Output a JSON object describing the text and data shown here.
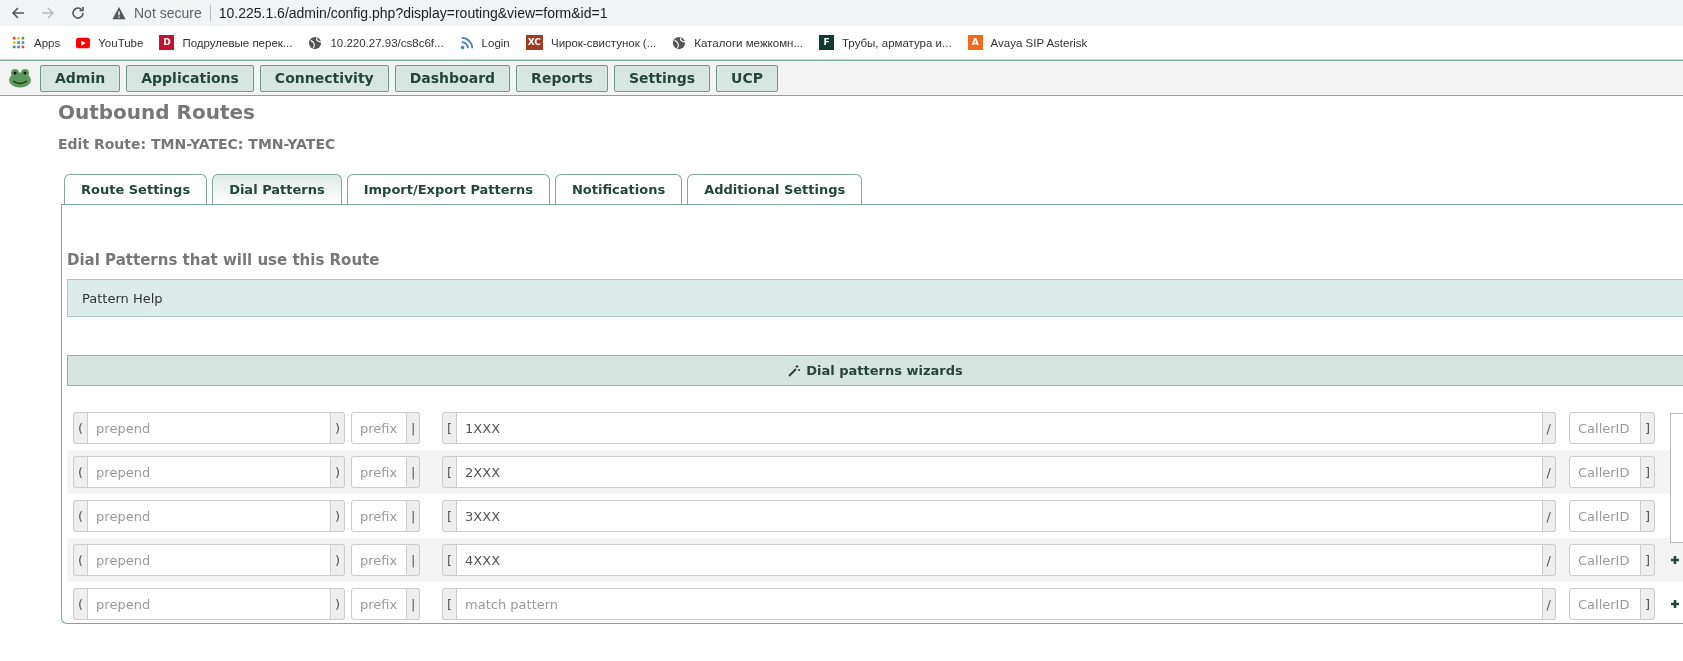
{
  "browser": {
    "security": "Not secure",
    "url": "10.225.1.6/admin/config.php?display=routing&view=form&id=1",
    "bookmarks": [
      {
        "kind": "apps",
        "label": "Apps"
      },
      {
        "kind": "youtube",
        "label": "YouTube"
      },
      {
        "kind": "badge",
        "badge": "D",
        "color": "#c8102e",
        "label": "Подрулевые перек..."
      },
      {
        "kind": "globe",
        "label": "10.220.27.93/cs8c6f..."
      },
      {
        "kind": "rss",
        "label": "Login"
      },
      {
        "kind": "badge",
        "badge": "XC",
        "color": "#a33a22",
        "label": "Чирок-свистунок (..."
      },
      {
        "kind": "globe",
        "label": "Каталоги межкомн..."
      },
      {
        "kind": "badge",
        "badge": "F",
        "color": "#0e3b2e",
        "label": "Трубы, арматура и..."
      },
      {
        "kind": "badge",
        "badge": "A",
        "color": "#f26b1d",
        "label": "Avaya SIP Asterisk"
      }
    ]
  },
  "menu": [
    "Admin",
    "Applications",
    "Connectivity",
    "Dashboard",
    "Reports",
    "Settings",
    "UCP"
  ],
  "page_title": "Outbound Routes",
  "subtitle": "Edit Route: TMN-YATEC: TMN-YATEC",
  "tabs": [
    {
      "label": "Route Settings",
      "selected": false
    },
    {
      "label": "Dial Patterns",
      "selected": true
    },
    {
      "label": "Import/Export Patterns",
      "selected": false
    },
    {
      "label": "Notifications",
      "selected": false
    },
    {
      "label": "Additional Settings",
      "selected": false
    }
  ],
  "section_title": "Dial Patterns that will use this Route",
  "pattern_help": "Pattern Help",
  "wizard_button": "Dial patterns wizards",
  "patterns": [
    {
      "addons": [
        "(",
        ")",
        "|",
        "[",
        "/",
        "]"
      ],
      "prepend_placeholder": "prepend",
      "prefix_placeholder": "prefix",
      "match": "1XXX",
      "callerid_placeholder": "CallerID",
      "add": false
    },
    {
      "addons": [
        "(",
        ")",
        "|",
        "[",
        "/",
        "]"
      ],
      "prepend_placeholder": "prepend",
      "prefix_placeholder": "prefix",
      "match": "2XXX",
      "callerid_placeholder": "CallerID",
      "add": false
    },
    {
      "addons": [
        "(",
        ")",
        "|",
        "[",
        "/",
        "]"
      ],
      "prepend_placeholder": "prepend",
      "prefix_placeholder": "prefix",
      "match": "3XXX",
      "callerid_placeholder": "CallerID",
      "add": false
    },
    {
      "addons": [
        "(",
        ")",
        "|",
        "[",
        "/",
        "]"
      ],
      "prepend_placeholder": "prepend",
      "prefix_placeholder": "prefix",
      "match": "4XXX",
      "callerid_placeholder": "CallerID",
      "add": true
    },
    {
      "addons": [
        "(",
        ")",
        "|",
        "[",
        "/",
        "]"
      ],
      "prepend_placeholder": "prepend",
      "prefix_placeholder": "prefix",
      "match_placeholder": "match pattern",
      "callerid_placeholder": "CallerID",
      "add": true
    }
  ]
}
